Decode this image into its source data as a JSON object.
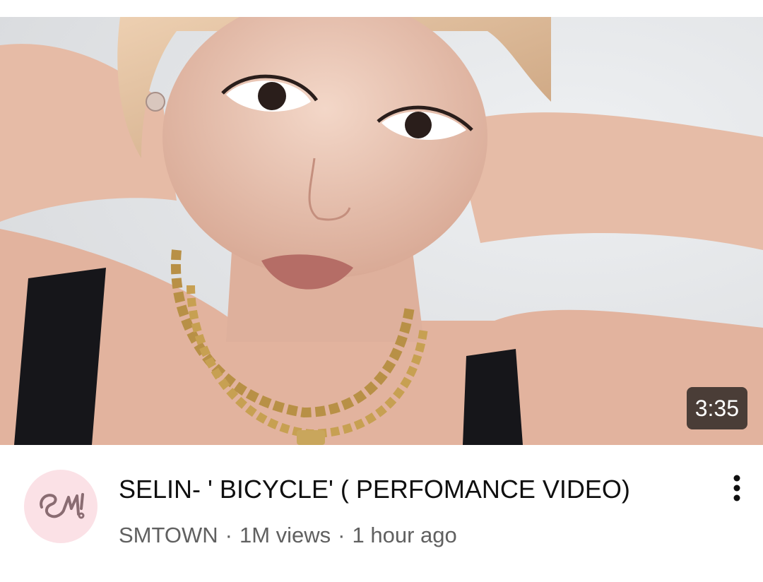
{
  "video": {
    "duration": "3:35",
    "title": "SELIN- ' BICYCLE' ( PERFOMANCE VIDEO)",
    "channel": "SMTOWN",
    "views": "1M views",
    "age": "1 hour ago",
    "separator": "·"
  },
  "icons": {
    "avatar": "sm-logo-icon",
    "menu": "more-vert-icon"
  },
  "colors": {
    "avatar_bg": "#fbe1e6",
    "avatar_logo": "#8a6c72",
    "title": "#0f0f0f",
    "meta": "#606060"
  }
}
